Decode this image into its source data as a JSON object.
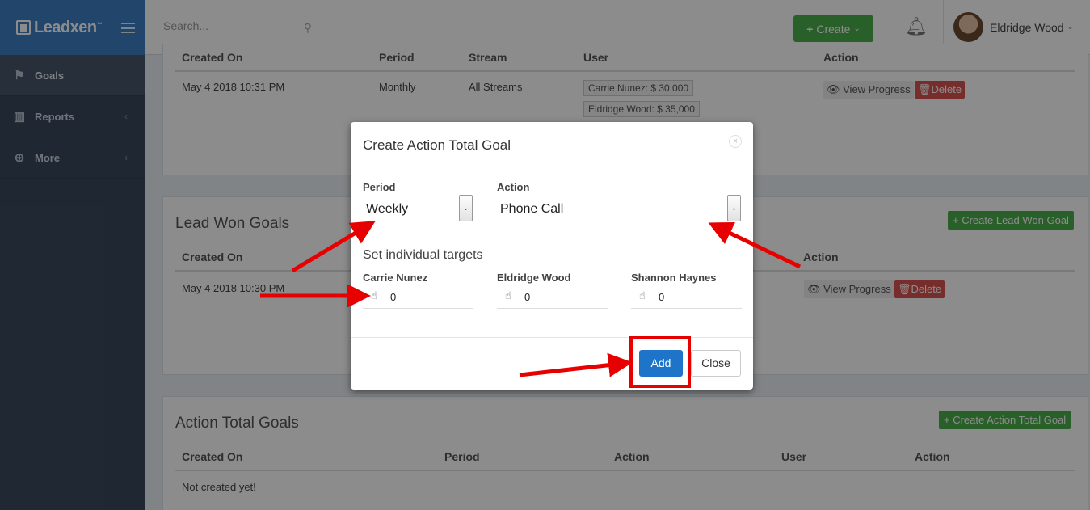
{
  "brand": {
    "name": "Leadxen",
    "tm": "™"
  },
  "sidebar": {
    "items": [
      {
        "label": "Goals",
        "icon": "flag-icon"
      },
      {
        "label": "Reports",
        "icon": "bar-chart-icon"
      },
      {
        "label": "More",
        "icon": "plus-circle-icon"
      }
    ]
  },
  "header": {
    "search_placeholder": "Search...",
    "create_label": "Create",
    "user_name": "Eldridge Wood"
  },
  "top_panel": {
    "columns": [
      "Created On",
      "Period",
      "Stream",
      "User",
      "Action"
    ],
    "row": {
      "created_on": "May 4 2018 10:31 PM",
      "period": "Monthly",
      "stream": "All Streams",
      "users": [
        "Carrie Nunez: $ 30,000",
        "Eldridge Wood: $ 35,000"
      ],
      "view_label": "View Progress",
      "delete_label": "Delete"
    }
  },
  "lead_won": {
    "title": "Lead Won Goals",
    "create_label": "Create Lead Won Goal",
    "columns": [
      "Created On",
      "Action"
    ],
    "row": {
      "created_on": "May 4 2018 10:30 PM",
      "view_label": "View Progress",
      "delete_label": "Delete"
    }
  },
  "action_total": {
    "title": "Action Total Goals",
    "create_label": "Create Action Total Goal",
    "columns": [
      "Created On",
      "Period",
      "Action",
      "User",
      "Action"
    ],
    "empty_text": "Not created yet!"
  },
  "modal": {
    "title": "Create Action Total Goal",
    "close_symbol": "×",
    "period_label": "Period",
    "period_value": "Weekly",
    "action_label": "Action",
    "action_value": "Phone Call",
    "targets_label": "Set individual targets",
    "targets": [
      {
        "name": "Carrie Nunez",
        "value": "0"
      },
      {
        "name": "Eldridge Wood",
        "value": "0"
      },
      {
        "name": "Shannon Haynes",
        "value": "0"
      }
    ],
    "add_label": "Add",
    "close_label": "Close"
  },
  "colors": {
    "brand_blue": "#3c7fc4",
    "sidebar": "#3a4a5c",
    "success": "#4cae4c",
    "danger": "#d9534f",
    "primary": "#1e74c9",
    "annotation_red": "#e60000"
  }
}
